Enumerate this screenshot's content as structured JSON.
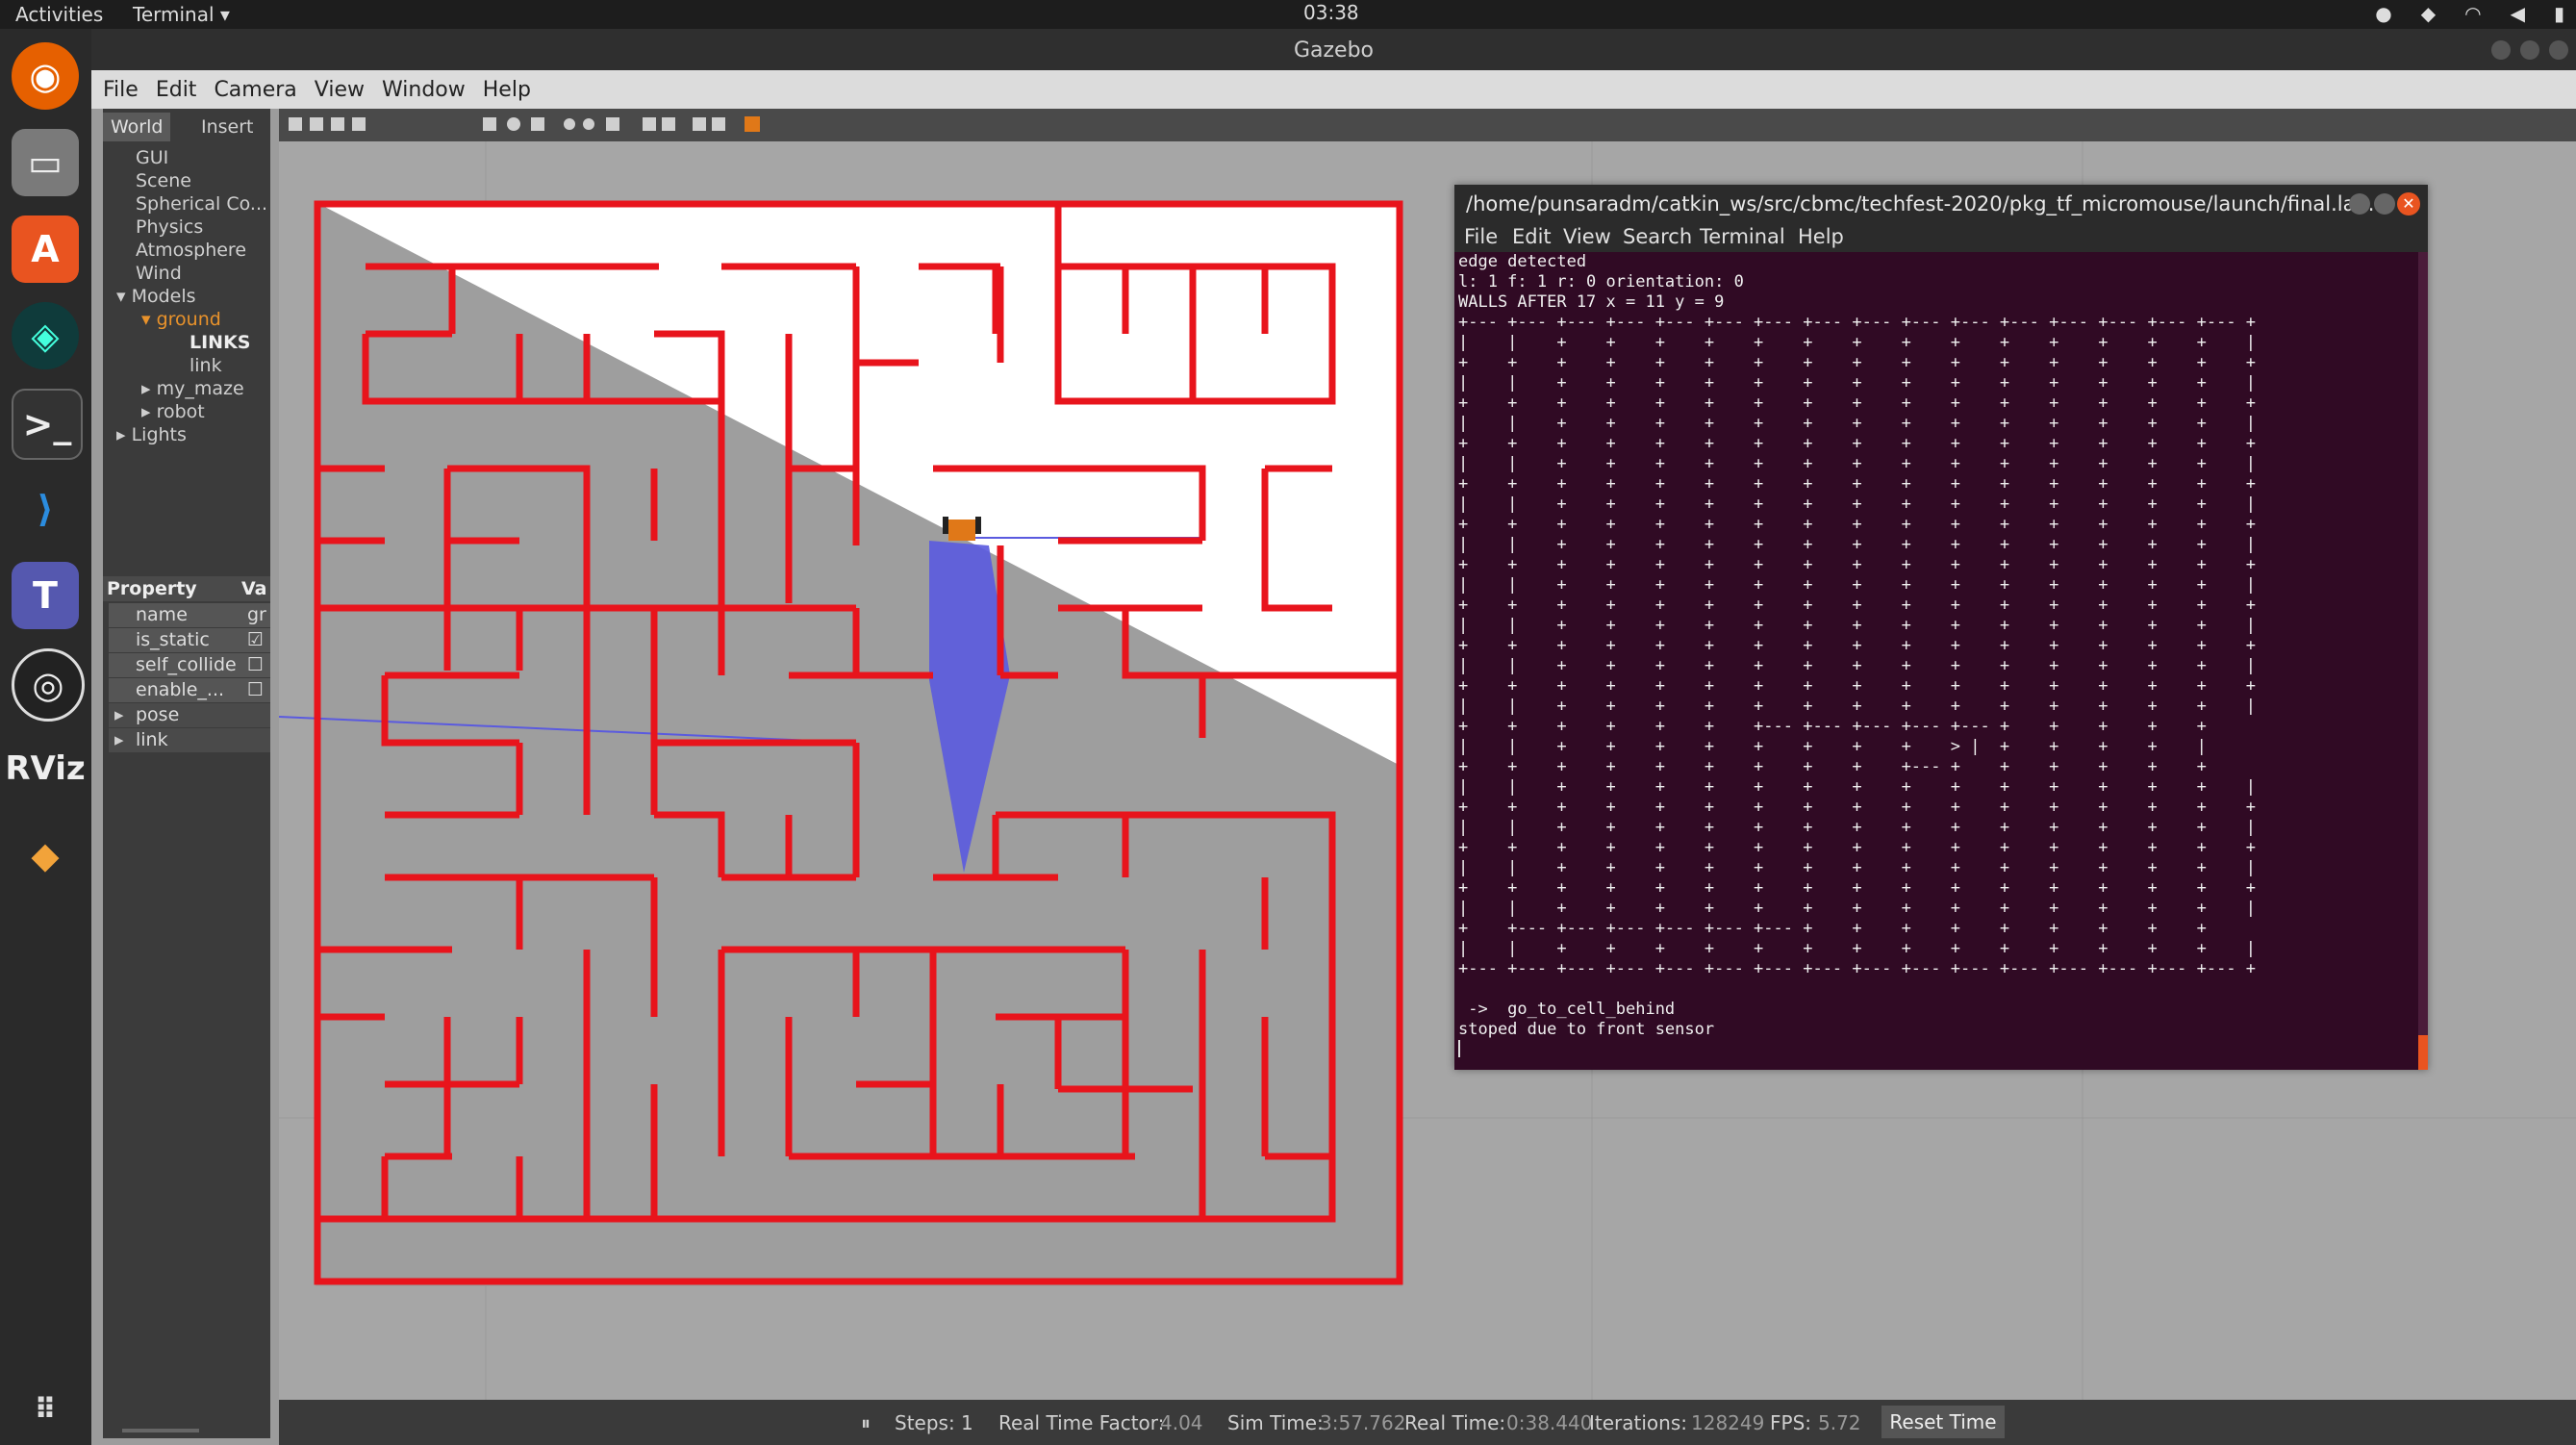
{
  "topbar": {
    "activities": "Activities",
    "app_menu": "Terminal ▾",
    "clock": "03:38"
  },
  "dock": {
    "items": [
      "firefox-icon",
      "files-icon",
      "software-icon",
      "gitkraken-icon",
      "terminal-icon",
      "vscode-icon",
      "teams-icon",
      "obs-icon",
      "rviz-icon",
      "sublime-icon",
      "apps-grid-icon"
    ]
  },
  "gazebo": {
    "window_title": "Gazebo",
    "menu": [
      "File",
      "Edit",
      "Camera",
      "View",
      "Window",
      "Help"
    ],
    "tabs": [
      "World",
      "Insert"
    ],
    "tree": [
      "GUI",
      "Scene",
      "Spherical Co...",
      "Physics",
      "Atmosphere",
      "Wind",
      "Models",
      "ground",
      "LINKS",
      "link",
      "my_maze",
      "robot",
      "Lights"
    ],
    "property_header": "Property",
    "value_header": "Va",
    "properties": [
      {
        "name": "name",
        "value": "gr"
      },
      {
        "name": "is_static",
        "value": "☑ T"
      },
      {
        "name": "self_collide",
        "value": "☐ F"
      },
      {
        "name": "enable_...",
        "value": "☐ F"
      },
      {
        "name": "pose",
        "value": ""
      },
      {
        "name": "link",
        "value": ""
      }
    ],
    "status": {
      "pause": "⏸",
      "steps_label": "Steps: 1",
      "rtf_label": "Real Time Factor:",
      "rtf_value": "4.04",
      "sim_label": "Sim Time:",
      "sim_value": "3:57.762",
      "real_label": "Real Time:",
      "real_value": "0:38.440",
      "iter_label": "Iterations:",
      "iter_value": "128249",
      "fps_label": "FPS:",
      "fps_value": "5.72",
      "reset": "Reset Time"
    },
    "colors": {
      "wall": "#e8141c",
      "floor": "#9e9e9e",
      "laser": "#5a5adf",
      "robot": "#e07818"
    }
  },
  "terminal": {
    "title": "/home/punsaradm/catkin_ws/src/cbmc/techfest-2020/pkg_tf_micromouse/launch/final.lau...",
    "menu": [
      "File",
      "Edit",
      "View",
      "Search",
      "Terminal",
      "Help"
    ],
    "lines": [
      "edge detected",
      "l: 1 f: 1 r: 0 orientation: 0",
      "WALLS AFTER 17 x = 11 y = 9"
    ],
    "maze_top": "+--- +--- +--- +--- +--- +--- +--- +--- +--- +--- +--- +--- +--- +--- +--- +--- +",
    "maze_row": "|    |    +    +    +    +    +    +    +    +    +    +    +    +    +    +    |",
    "maze_plus": "+    +    +    +    +    +    +    +    +    +    +    +    +    +    +    +    +",
    "maze_mid_a": "+    +    +    +    +    +    +--- +--- +--- +--- +--- +    +    +    +    +",
    "maze_mid_b": "|    |    +    +    +    +    +    +    +    +    > |  +    +    +    +    |",
    "maze_mid_c": "+    +    +    +    +    +    +    +    +    +--- +    +    +    +    +    +",
    "maze_bottom_inner": "+    +--- +--- +--- +--- +--- +--- +    +    +    +    +    +    +    +    +",
    "cmd": " ->  go_to_cell_behind",
    "status_line": "stoped due to front sensor"
  }
}
